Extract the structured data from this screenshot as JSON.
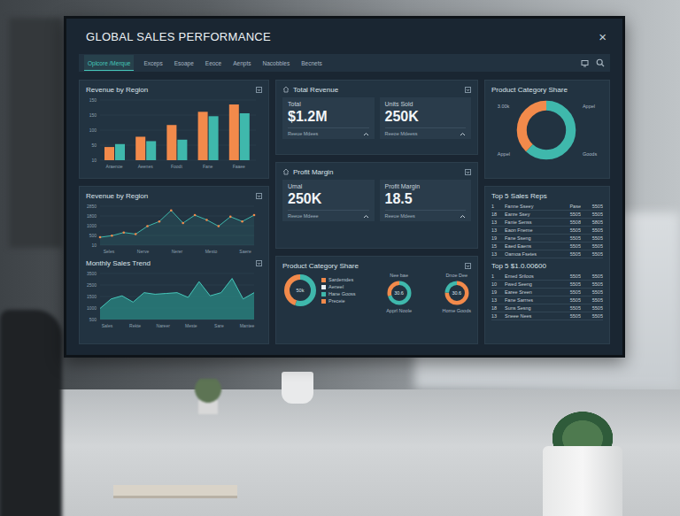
{
  "window": {
    "title": "GLOBAL SALES PERFORMANCE",
    "close": "×"
  },
  "tabs": [
    {
      "label": "Oplcore /Merque",
      "selected": true
    },
    {
      "label": "Exceps",
      "selected": false
    },
    {
      "label": "Esoape",
      "selected": false
    },
    {
      "label": "Eeoce",
      "selected": false
    },
    {
      "label": "Aenpts",
      "selected": false
    },
    {
      "label": "Nacobbles",
      "selected": false
    },
    {
      "label": "Becnets",
      "selected": false
    }
  ],
  "revenue_bars": {
    "title": "Revenue by Region",
    "ticks": [
      "150",
      "150",
      "100",
      "50",
      "10"
    ],
    "categories": [
      "Araenoe",
      "Aeenes",
      "Foodt",
      "Fane",
      "Faaee"
    ],
    "series": [
      {
        "color": "#f28a4b",
        "values": [
          45,
          80,
          120,
          165,
          190
        ]
      },
      {
        "color": "#3fb8ac",
        "values": [
          55,
          65,
          70,
          150,
          160
        ]
      }
    ]
  },
  "revenue_line": {
    "title": "Revenue by Region",
    "ticks": [
      "2850",
      "1800",
      "1000",
      "500",
      "10"
    ],
    "labels": [
      "Seles",
      "Nerve",
      "Nerer",
      "Mesto",
      "Saere"
    ],
    "values": [
      500,
      600,
      800,
      700,
      1200,
      1500,
      2200,
      1400,
      1900,
      1600,
      1200,
      1800,
      1500,
      1900
    ]
  },
  "monthly_trend": {
    "title": "Monthly Sales Trend",
    "ticks": [
      "3500",
      "2500",
      "1500",
      "1000",
      "500"
    ],
    "labels": [
      "Sales",
      "Rekte",
      "Nareer",
      "Meste",
      "Sare",
      "Mantee"
    ],
    "values": [
      700,
      1300,
      1500,
      1100,
      1700,
      1600,
      1650,
      1700,
      1400,
      2400,
      1500,
      1700,
      2600,
      1300,
      1700
    ]
  },
  "total_revenue": {
    "title": "Total Revenue",
    "tiles": [
      {
        "label": "Total",
        "value": "$1.2M",
        "note": "Reeue Mdees"
      },
      {
        "label": "Units Sold",
        "value": "250K",
        "note": "Reeoe Mdeess"
      }
    ]
  },
  "profit_margin": {
    "title": "Profit Margin",
    "tiles": [
      {
        "label": "Umal",
        "value": "250K",
        "note": "Reeue Mdeee"
      },
      {
        "label": "Profit Margin",
        "value": "18.5",
        "note": "Reeue Mdees"
      }
    ]
  },
  "category_small": {
    "title": "Product Category Share",
    "donuts": [
      {
        "center": "50k",
        "segments": [
          {
            "share": 0.55,
            "color": "#3fb8ac"
          },
          {
            "share": 0.45,
            "color": "#f28a4b"
          }
        ],
        "legend": [
          {
            "label": "Sardemdes",
            "color": "#f28a4b"
          },
          {
            "label": "Aeneel",
            "color": "#e8eef2"
          },
          {
            "label": "Hane Gooss",
            "color": "#3fb8ac"
          },
          {
            "label": "Preceie",
            "color": "#f28a4b"
          }
        ]
      },
      {
        "heading": "Nee bae",
        "center": "30.6",
        "caption": "Apprl Noole",
        "segments": [
          {
            "share": 0.7,
            "color": "#3fb8ac"
          },
          {
            "share": 0.3,
            "color": "#f28a4b"
          }
        ]
      },
      {
        "heading": "Dnoe Dee",
        "center": "30.6",
        "caption": "Home Goods",
        "segments": [
          {
            "share": 0.75,
            "color": "#f28a4b"
          },
          {
            "share": 0.25,
            "color": "#3fb8ac"
          }
        ]
      }
    ]
  },
  "category_share": {
    "title": "Product Category Share",
    "labels": [
      "3.00k",
      "Appel",
      "Appel",
      "Goods"
    ],
    "segments": [
      {
        "share": 0.62,
        "color": "#3fb8ac"
      },
      {
        "share": 0.38,
        "color": "#f28a4b"
      }
    ]
  },
  "sales_reps": {
    "title": "Top 5 Sales Reps",
    "rows": [
      [
        "1",
        "Fanne Sseey",
        "Pase",
        "5505"
      ],
      [
        "18",
        "Eanre Ssey",
        "5505",
        "5505"
      ],
      [
        "13",
        "Fanie Senss",
        "5508",
        "5805"
      ],
      [
        "13",
        "Eaon Fneme",
        "5505",
        "5505"
      ],
      [
        "19",
        "Fane Sseng",
        "5505",
        "5505"
      ],
      [
        "15",
        "Eaed Eaens",
        "5505",
        "5505"
      ],
      [
        "13",
        "Oamoa Fsetes",
        "5505",
        "5505"
      ]
    ]
  },
  "top_table": {
    "title": "Top 5 $1.0.00600",
    "rows": [
      [
        "1",
        "Emed Sriloos",
        "5505",
        "5505"
      ],
      [
        "10",
        "Fwed Seeng",
        "5505",
        "5505"
      ],
      [
        "19",
        "Earee Sreen",
        "5505",
        "5505"
      ],
      [
        "13",
        "Fane Sarrres",
        "5505",
        "5505"
      ],
      [
        "18",
        "Suns Sesng",
        "5505",
        "5505"
      ],
      [
        "13",
        "Sneee Nees",
        "5505",
        "5505"
      ]
    ]
  }
}
